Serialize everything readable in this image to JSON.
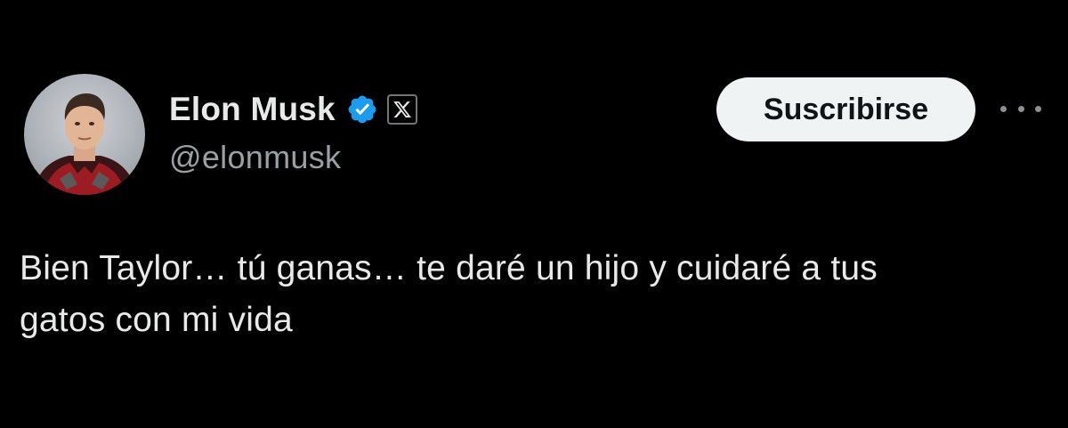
{
  "tweet": {
    "author": {
      "display_name": "Elon Musk",
      "handle": "@elonmusk",
      "verified_color": "#1d9bf0"
    },
    "actions": {
      "subscribe_label": "Suscribirse"
    },
    "text_lines": [
      "Bien Taylor… tú ganas… te daré un hijo y cuidaré a tus",
      "gatos con mi vida"
    ]
  },
  "icons": {
    "verified": "verified-badge-icon",
    "affiliate": "x-logo-icon",
    "more": "more-options-icon"
  }
}
